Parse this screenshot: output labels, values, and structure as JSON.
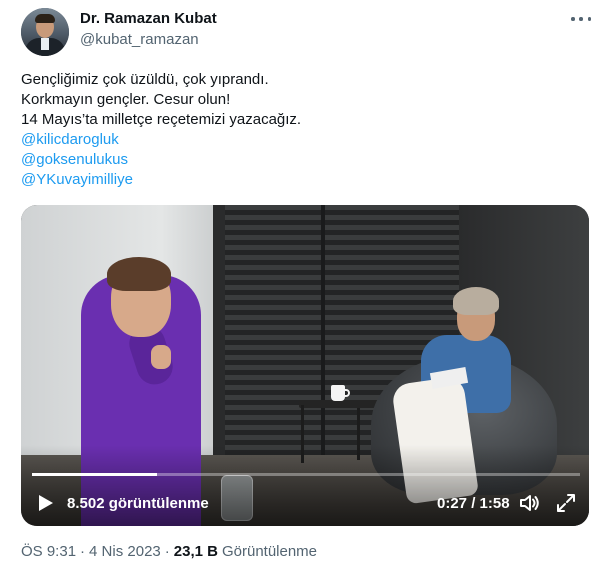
{
  "author": {
    "name": "Dr. Ramazan Kubat",
    "handle": "@kubat_ramazan",
    "avatar_icon": "profile-photo"
  },
  "tweet": {
    "lines": [
      "Gençliğimiz çok üzüldü, çok yıprandı.",
      "Korkmayın gençler. Cesur olun!",
      "14 Mayıs’ta milletçe reçetemizi yazacağız."
    ],
    "mentions": [
      "@kilicdarogluk",
      "@goksenulukus",
      "@YKuvayimilliye"
    ]
  },
  "video": {
    "views_text": "8.502 görüntülenme",
    "time_text": "0:27 / 1:58",
    "progress_fraction": 0.2288,
    "play_icon": "play-icon",
    "volume_icon": "volume-icon",
    "fullscreen_icon": "expand-icon"
  },
  "meta": {
    "time": "ÖS 9:31",
    "date": "4 Nis 2023",
    "views_count": "23,1 B",
    "views_label": "Görüntülenme"
  },
  "colors": {
    "accent": "#1d9bf0",
    "text": "#0f1419",
    "secondary": "#536471"
  }
}
